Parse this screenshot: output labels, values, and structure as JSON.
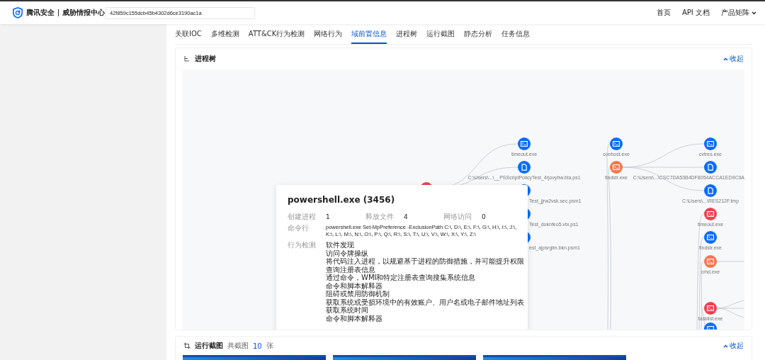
{
  "brand": {
    "name": "腾讯安全",
    "product": "威胁情报中心"
  },
  "search": {
    "value": "42f859c155dcb45b4302d6ce3190ac1a"
  },
  "nav": [
    {
      "label": "首页",
      "kind": "link"
    },
    {
      "label": "API 文档",
      "kind": "link"
    },
    {
      "label": "产品矩阵",
      "kind": "menu"
    }
  ],
  "tabs": [
    {
      "label": "关联IOC",
      "selected": false
    },
    {
      "label": "多维检测",
      "selected": false
    },
    {
      "label": "ATT&CK行为检测",
      "selected": false
    },
    {
      "label": "网络行为",
      "selected": false
    },
    {
      "label": "域前置信息",
      "selected": true
    },
    {
      "label": "进程树",
      "selected": false
    },
    {
      "label": "运行截图",
      "selected": false
    },
    {
      "label": "静态分析",
      "selected": false
    },
    {
      "label": "任务信息",
      "selected": false
    }
  ],
  "process_tree": {
    "title": "进程树",
    "collapse": "收起",
    "nodes": [
      {
        "color": "#ee4150"
      },
      {
        "kind": "process",
        "color": "#0a6cff",
        "label": "timeout.exe"
      },
      {
        "kind": "file",
        "color": "#0a6cff",
        "label": "C:\\Users\\...\\__PSScriptPolicyTest_4rjovyhw.bla.ps1"
      },
      {
        "color": "#0a6cff",
        "label": "Test_jjrw2vsk.sec.psm1"
      },
      {
        "kind": "file",
        "color": "#0a6cff",
        "label": "Test_doknfeo5.vtx.ps1"
      },
      {
        "kind": "file",
        "color": "#0a6cff",
        "label": "est_ajpsrglm.bkn.psm1"
      },
      {
        "kind": "process",
        "color": "#0a6cff",
        "label": "conhost.exe"
      },
      {
        "kind": "process",
        "color": "#f5774e",
        "label": "findstr.exe"
      },
      {
        "kind": "process",
        "color": "#0a6cff",
        "label": "cvtres.exe"
      },
      {
        "kind": "file",
        "color": "#0a6cff",
        "label": "C:\\Users\\...\\CSC7DA53B4DF8054ACCA1ED9C9A"
      },
      {
        "kind": "file",
        "color": "#0a6cff",
        "label": "C:\\Users\\...\\RES212F.tmp"
      },
      {
        "kind": "process",
        "color": "#ee4150",
        "label": "timeout.exe"
      },
      {
        "kind": "process",
        "color": "#0a6cff",
        "label": "findstr.exe"
      },
      {
        "kind": "process",
        "color": "#f5774e",
        "label": "cmd.exe"
      },
      {
        "kind": "process",
        "color": "#ee4150",
        "label": "tasklist.exe"
      },
      {
        "kind": "process",
        "color": "#0a6cff"
      }
    ],
    "detail": {
      "title": "powershell.exe (3456)",
      "stats": [
        {
          "label": "创建进程",
          "value": "1"
        },
        {
          "label": "释放文件",
          "value": "4"
        },
        {
          "label": "网络访问",
          "value": "0"
        }
      ],
      "command": {
        "label": "命令行",
        "value": "powershell.exe Set-MpPreference -ExclusionPath C:\\, D:\\, E:\\, F:\\, G:\\, H:\\, I:\\, J:\\, K:\\, L:\\, M:\\, N:\\, O:\\, P:\\, Q:\\, R:\\, S:\\, T:\\, U:\\, V:\\, W:\\, X:\\, Y:\\, Z:\\"
      },
      "behaviors": {
        "label": "行为检测",
        "items": [
          "软件发现",
          "访问令牌操纵",
          "将代码注入进程，以规避基于进程的防御措施，并可能提升权限",
          "查询注册表信息",
          "通过命令，WMI和特定注册表查询搜集系统信息",
          "命令和脚本解释器",
          "阻碍或禁用防御机制",
          "获取系统或受损环境中的有效账户、用户名或电子邮件地址列表",
          "获取系统时间",
          "命令和脚本解释器"
        ]
      }
    }
  },
  "screenshots": {
    "title": "运行截图",
    "count_prefix": "共截图",
    "count": "10",
    "count_suffix": "张",
    "collapse": "收起"
  }
}
